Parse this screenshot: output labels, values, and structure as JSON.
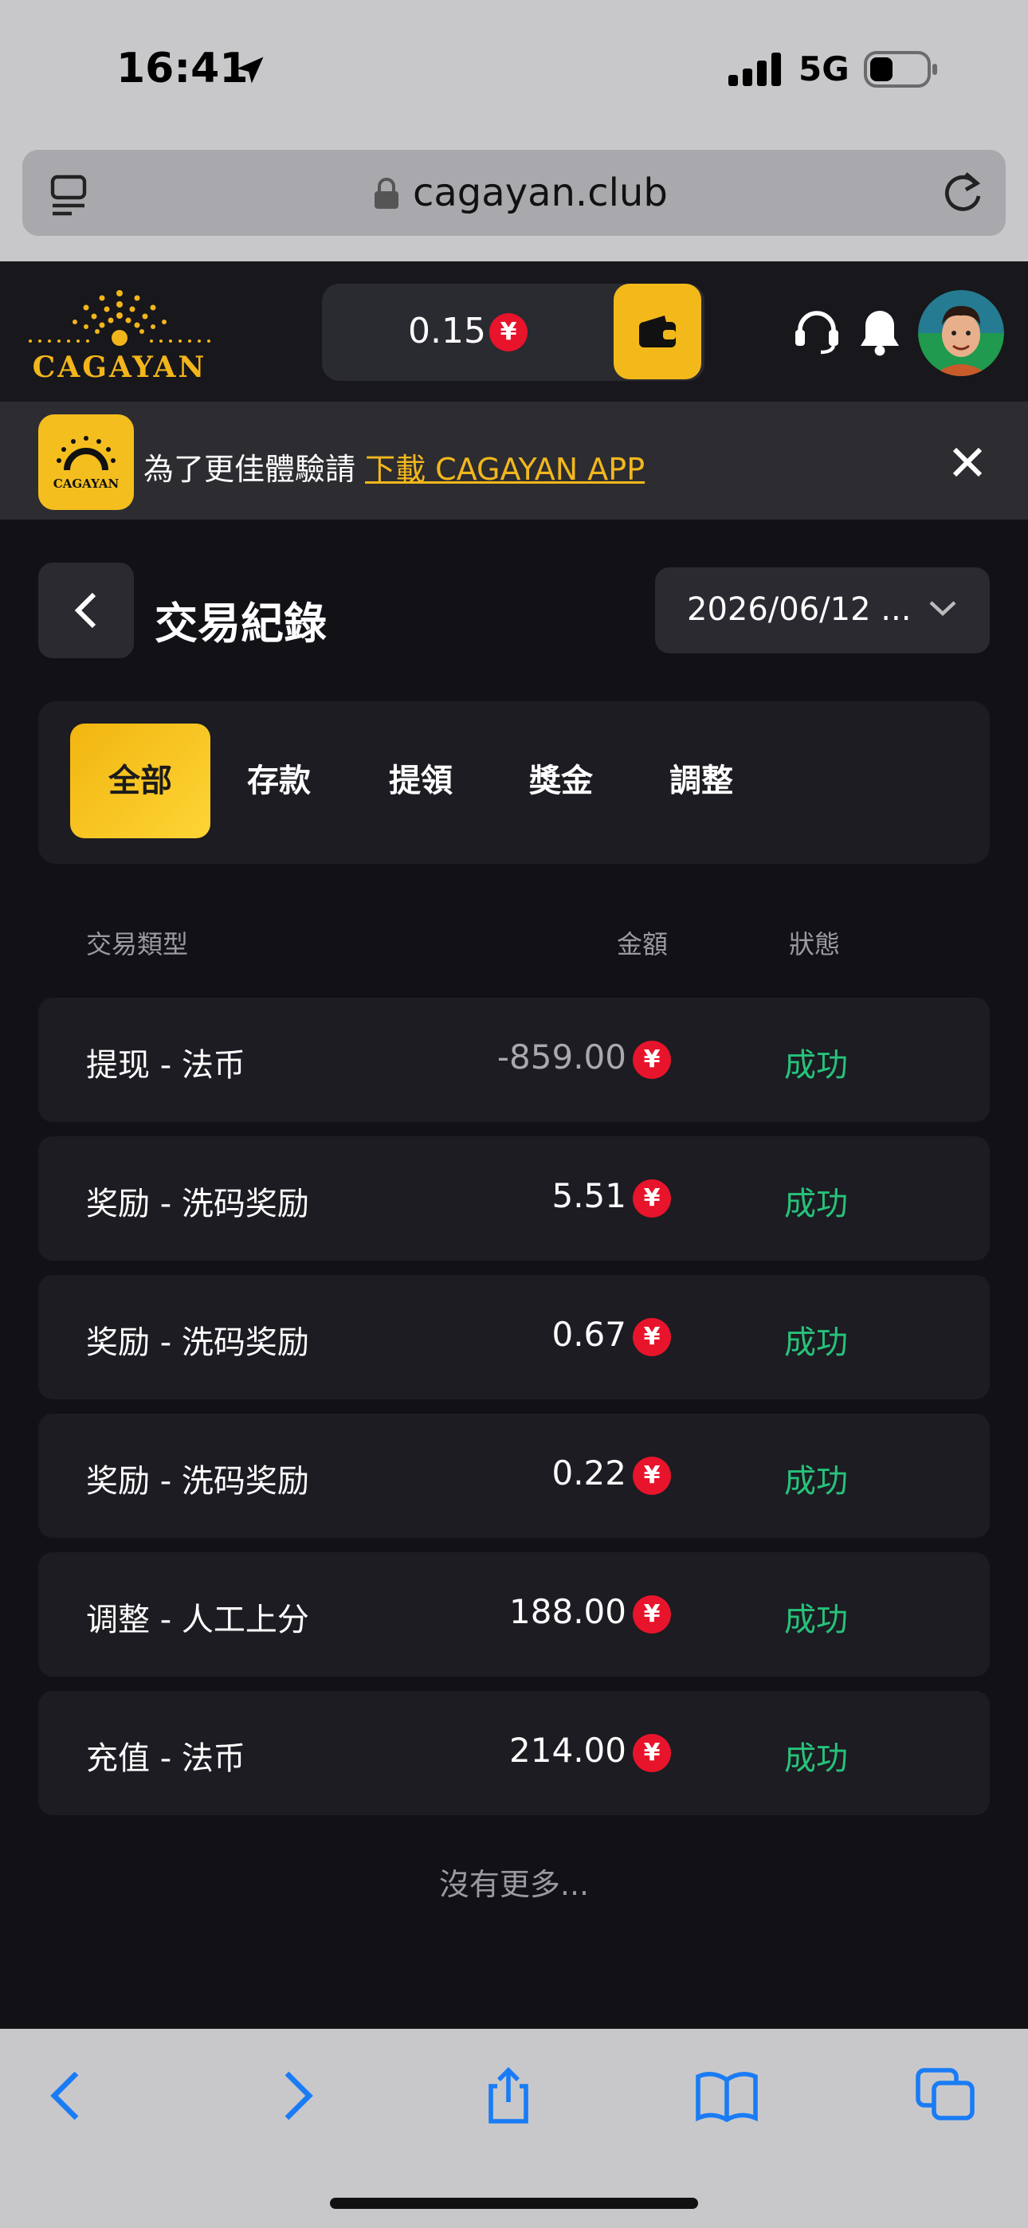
{
  "status_bar": {
    "time": "16:41",
    "network": "5G"
  },
  "browser": {
    "url": "cagayan.club"
  },
  "header": {
    "logo_text": "CAGAYAN",
    "balance": "0.15",
    "currency_symbol": "¥"
  },
  "banner": {
    "text": "為了更佳體驗請 ",
    "link": "下載 CAGAYAN APP",
    "app_icon_text": "CAGAYAN"
  },
  "page": {
    "title": "交易紀錄",
    "date_filter": "2026/06/12 ..."
  },
  "tabs": [
    {
      "label": "全部",
      "active": true
    },
    {
      "label": "存款",
      "active": false
    },
    {
      "label": "提領",
      "active": false
    },
    {
      "label": "獎金",
      "active": false
    },
    {
      "label": "調整",
      "active": false
    }
  ],
  "table": {
    "headers": {
      "type": "交易類型",
      "amount": "金額",
      "status": "狀態"
    },
    "rows": [
      {
        "type": "提现 - 法币",
        "amount": "-859.00",
        "status": "成功"
      },
      {
        "type": "奖励 - 洗码奖励",
        "amount": "5.51",
        "status": "成功"
      },
      {
        "type": "奖励 - 洗码奖励",
        "amount": "0.67",
        "status": "成功"
      },
      {
        "type": "奖励 - 洗码奖励",
        "amount": "0.22",
        "status": "成功"
      },
      {
        "type": "调整 - 人工上分",
        "amount": "188.00",
        "status": "成功"
      },
      {
        "type": "充值 - 法币",
        "amount": "214.00",
        "status": "成功"
      }
    ],
    "footer": "沒有更多..."
  },
  "colors": {
    "accent": "#f3b91b",
    "success": "#27c27a",
    "coin": "#e8142b",
    "background": "#111116"
  }
}
